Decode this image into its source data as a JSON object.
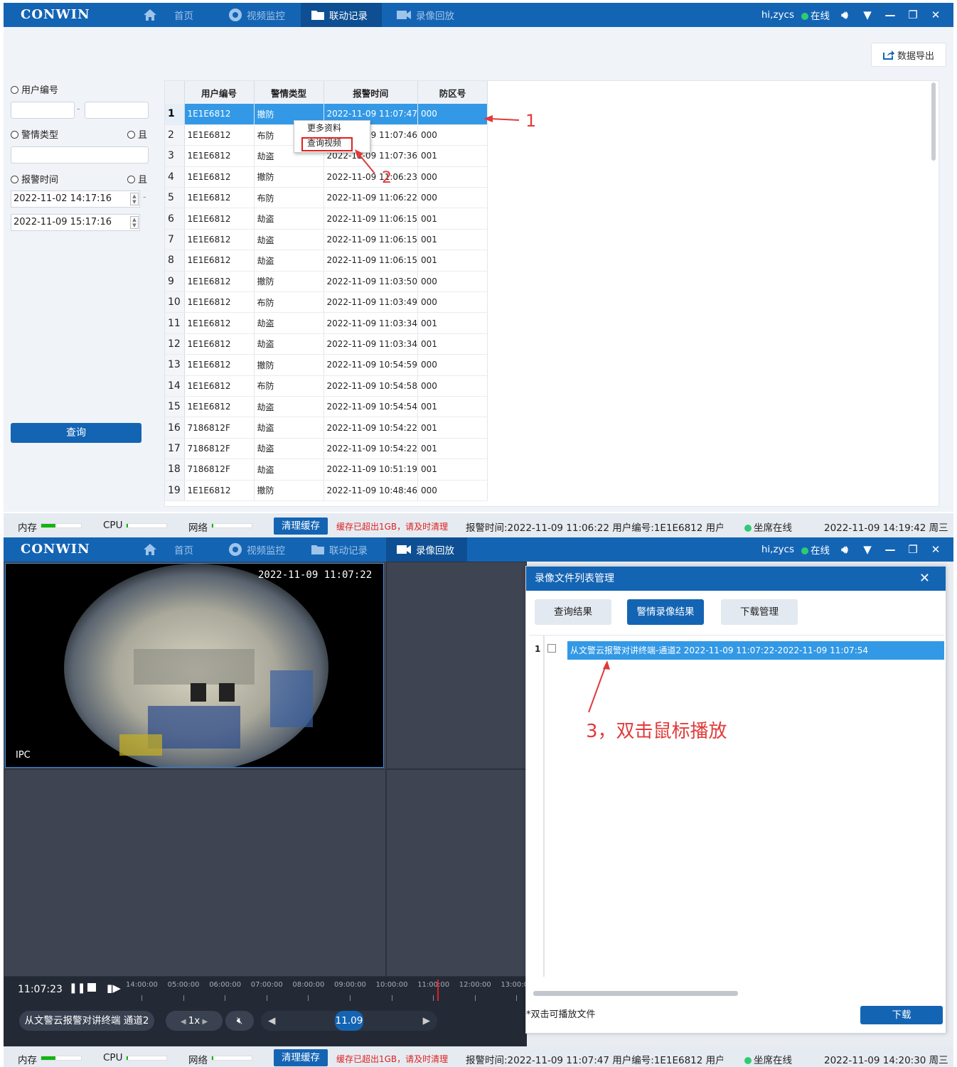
{
  "app": {
    "logo": "CONWIN",
    "user": "hi,zycs",
    "online": "在线"
  },
  "nav": {
    "home": "首页",
    "video": "视频监控",
    "linkage": "联动记录",
    "playback": "录像回放"
  },
  "top": {
    "export_label": "数据导出",
    "filters": {
      "user_id": "用户编号",
      "alarm_type": "警情类型",
      "alarm_time": "报警时间",
      "and1": "且",
      "and2": "且",
      "start": "2022-11-02 14:17:16",
      "end": "2022-11-09 15:17:16",
      "query": "查询"
    },
    "columns": [
      "用户编号",
      "警情类型",
      "报警时间",
      "防区号"
    ],
    "rows": [
      [
        "1",
        "1E1E6812",
        "撤防",
        "2022-11-09 11:07:47",
        "000"
      ],
      [
        "2",
        "1E1E6812",
        "布防",
        "2022-11-09 11:07:46",
        "000"
      ],
      [
        "3",
        "1E1E6812",
        "劫盗",
        "2022-11-09 11:07:36",
        "001"
      ],
      [
        "4",
        "1E1E6812",
        "撤防",
        "2022-11-09 11:06:23",
        "000"
      ],
      [
        "5",
        "1E1E6812",
        "布防",
        "2022-11-09 11:06:22",
        "000"
      ],
      [
        "6",
        "1E1E6812",
        "劫盗",
        "2022-11-09 11:06:15",
        "001"
      ],
      [
        "7",
        "1E1E6812",
        "劫盗",
        "2022-11-09 11:06:15",
        "001"
      ],
      [
        "8",
        "1E1E6812",
        "劫盗",
        "2022-11-09 11:06:15",
        "001"
      ],
      [
        "9",
        "1E1E6812",
        "撤防",
        "2022-11-09 11:03:50",
        "000"
      ],
      [
        "10",
        "1E1E6812",
        "布防",
        "2022-11-09 11:03:49",
        "000"
      ],
      [
        "11",
        "1E1E6812",
        "劫盗",
        "2022-11-09 11:03:34",
        "001"
      ],
      [
        "12",
        "1E1E6812",
        "劫盗",
        "2022-11-09 11:03:34",
        "001"
      ],
      [
        "13",
        "1E1E6812",
        "撤防",
        "2022-11-09 10:54:59",
        "000"
      ],
      [
        "14",
        "1E1E6812",
        "布防",
        "2022-11-09 10:54:58",
        "000"
      ],
      [
        "15",
        "1E1E6812",
        "劫盗",
        "2022-11-09 10:54:54",
        "001"
      ],
      [
        "16",
        "7186812F",
        "劫盗",
        "2022-11-09 10:54:22",
        "001"
      ],
      [
        "17",
        "7186812F",
        "劫盗",
        "2022-11-09 10:54:22",
        "001"
      ],
      [
        "18",
        "7186812F",
        "劫盗",
        "2022-11-09 10:51:19",
        "001"
      ],
      [
        "19",
        "1E1E6812",
        "撤防",
        "2022-11-09 10:48:46",
        "000"
      ]
    ],
    "context_menu": [
      "更多资料",
      "查询视频"
    ],
    "annotation1": "1",
    "annotation2": "2"
  },
  "status1": {
    "mem": "内存",
    "cpu": "CPU",
    "net": "网络",
    "clear": "清理缓存",
    "warn": "缓存已超出1GB，请及时清理",
    "info": "报警时间:2022-11-09 11:06:22  用户编号:1E1E6812  用户",
    "seat": "坐席在线",
    "clock": "2022-11-09 14:19:42 周三"
  },
  "status2": {
    "mem": "内存",
    "cpu": "CPU",
    "net": "网络",
    "clear": "清理缓存",
    "warn": "缓存已超出1GB，请及时清理",
    "info": "报警时间:2022-11-09 11:07:47  用户编号:1E1E6812  用户",
    "seat": "坐席在线",
    "clock": "2022-11-09 14:20:30 周三"
  },
  "bottom": {
    "cam_time": "2022-11-09 11:07:22",
    "cam_label": "IPC",
    "current_time": "11:07:23",
    "ticks": [
      "14:00:00",
      "05:00:00",
      "06:00:00",
      "07:00:00",
      "08:00:00",
      "09:00:00",
      "10:00:00",
      "11:00:00",
      "12:00:00",
      "13:00:0"
    ],
    "channel": "从文警云报警对讲终端 通道2",
    "speed": "1x",
    "date": "11.09",
    "dialog": {
      "title": "录像文件列表管理",
      "tabs": [
        "查询结果",
        "警情录像结果",
        "下载管理"
      ],
      "row_index": "1",
      "file": "从文警云报警对讲终端-通道2 2022-11-09 11:07:22-2022-11-09 11:07:54",
      "annotation3": "3，双击鼠标播放",
      "hint": "*双击可播放文件",
      "download": "下载"
    }
  }
}
